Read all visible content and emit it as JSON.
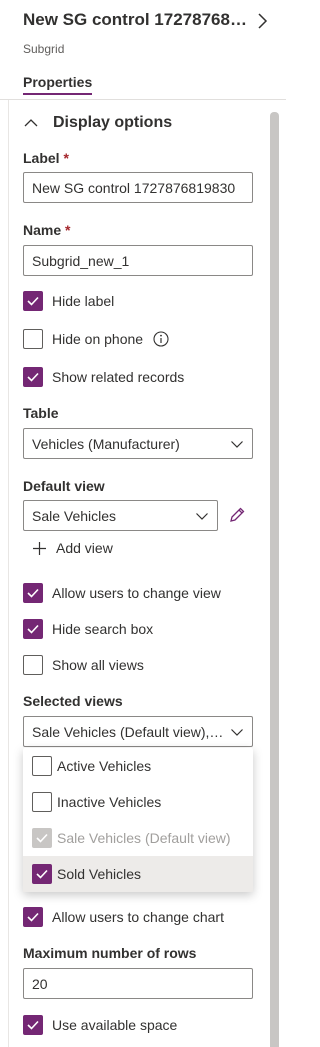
{
  "header": {
    "title": "New SG control 1727876819...",
    "subtitle": "Subgrid",
    "tab": "Properties"
  },
  "section": {
    "title": "Display options"
  },
  "label_field": {
    "label": "Label",
    "required": "*",
    "value": "New SG control 1727876819830"
  },
  "name_field": {
    "label": "Name",
    "required": "*",
    "value": "Subgrid_new_1"
  },
  "checkboxes": {
    "hide_label": {
      "label": "Hide label",
      "checked": true
    },
    "hide_on_phone": {
      "label": "Hide on phone",
      "checked": false
    },
    "show_related": {
      "label": "Show related records",
      "checked": true
    },
    "allow_change_view": {
      "label": "Allow users to change view",
      "checked": true
    },
    "hide_search": {
      "label": "Hide search box",
      "checked": true
    },
    "show_all_views": {
      "label": "Show all views",
      "checked": false
    },
    "allow_change_chart": {
      "label": "Allow users to change chart",
      "checked": true
    },
    "use_space": {
      "label": "Use available space",
      "checked": true
    }
  },
  "table_field": {
    "label": "Table",
    "value": "Vehicles (Manufacturer)"
  },
  "default_view": {
    "label": "Default view",
    "value": "Sale Vehicles",
    "add_label": "Add view"
  },
  "selected_views": {
    "label": "Selected views",
    "value": "Sale Vehicles (Default view), S...",
    "options": [
      {
        "label": "Active Vehicles",
        "checked": false,
        "disabled": false
      },
      {
        "label": "Inactive Vehicles",
        "checked": false,
        "disabled": false
      },
      {
        "label": "Sale Vehicles (Default view)",
        "checked": true,
        "disabled": true
      },
      {
        "label": "Sold Vehicles",
        "checked": true,
        "disabled": false
      }
    ]
  },
  "max_rows": {
    "label": "Maximum number of rows",
    "value": "20"
  },
  "colors": {
    "accent": "#742774",
    "border": "#8a8886",
    "required": "#a4262c"
  }
}
